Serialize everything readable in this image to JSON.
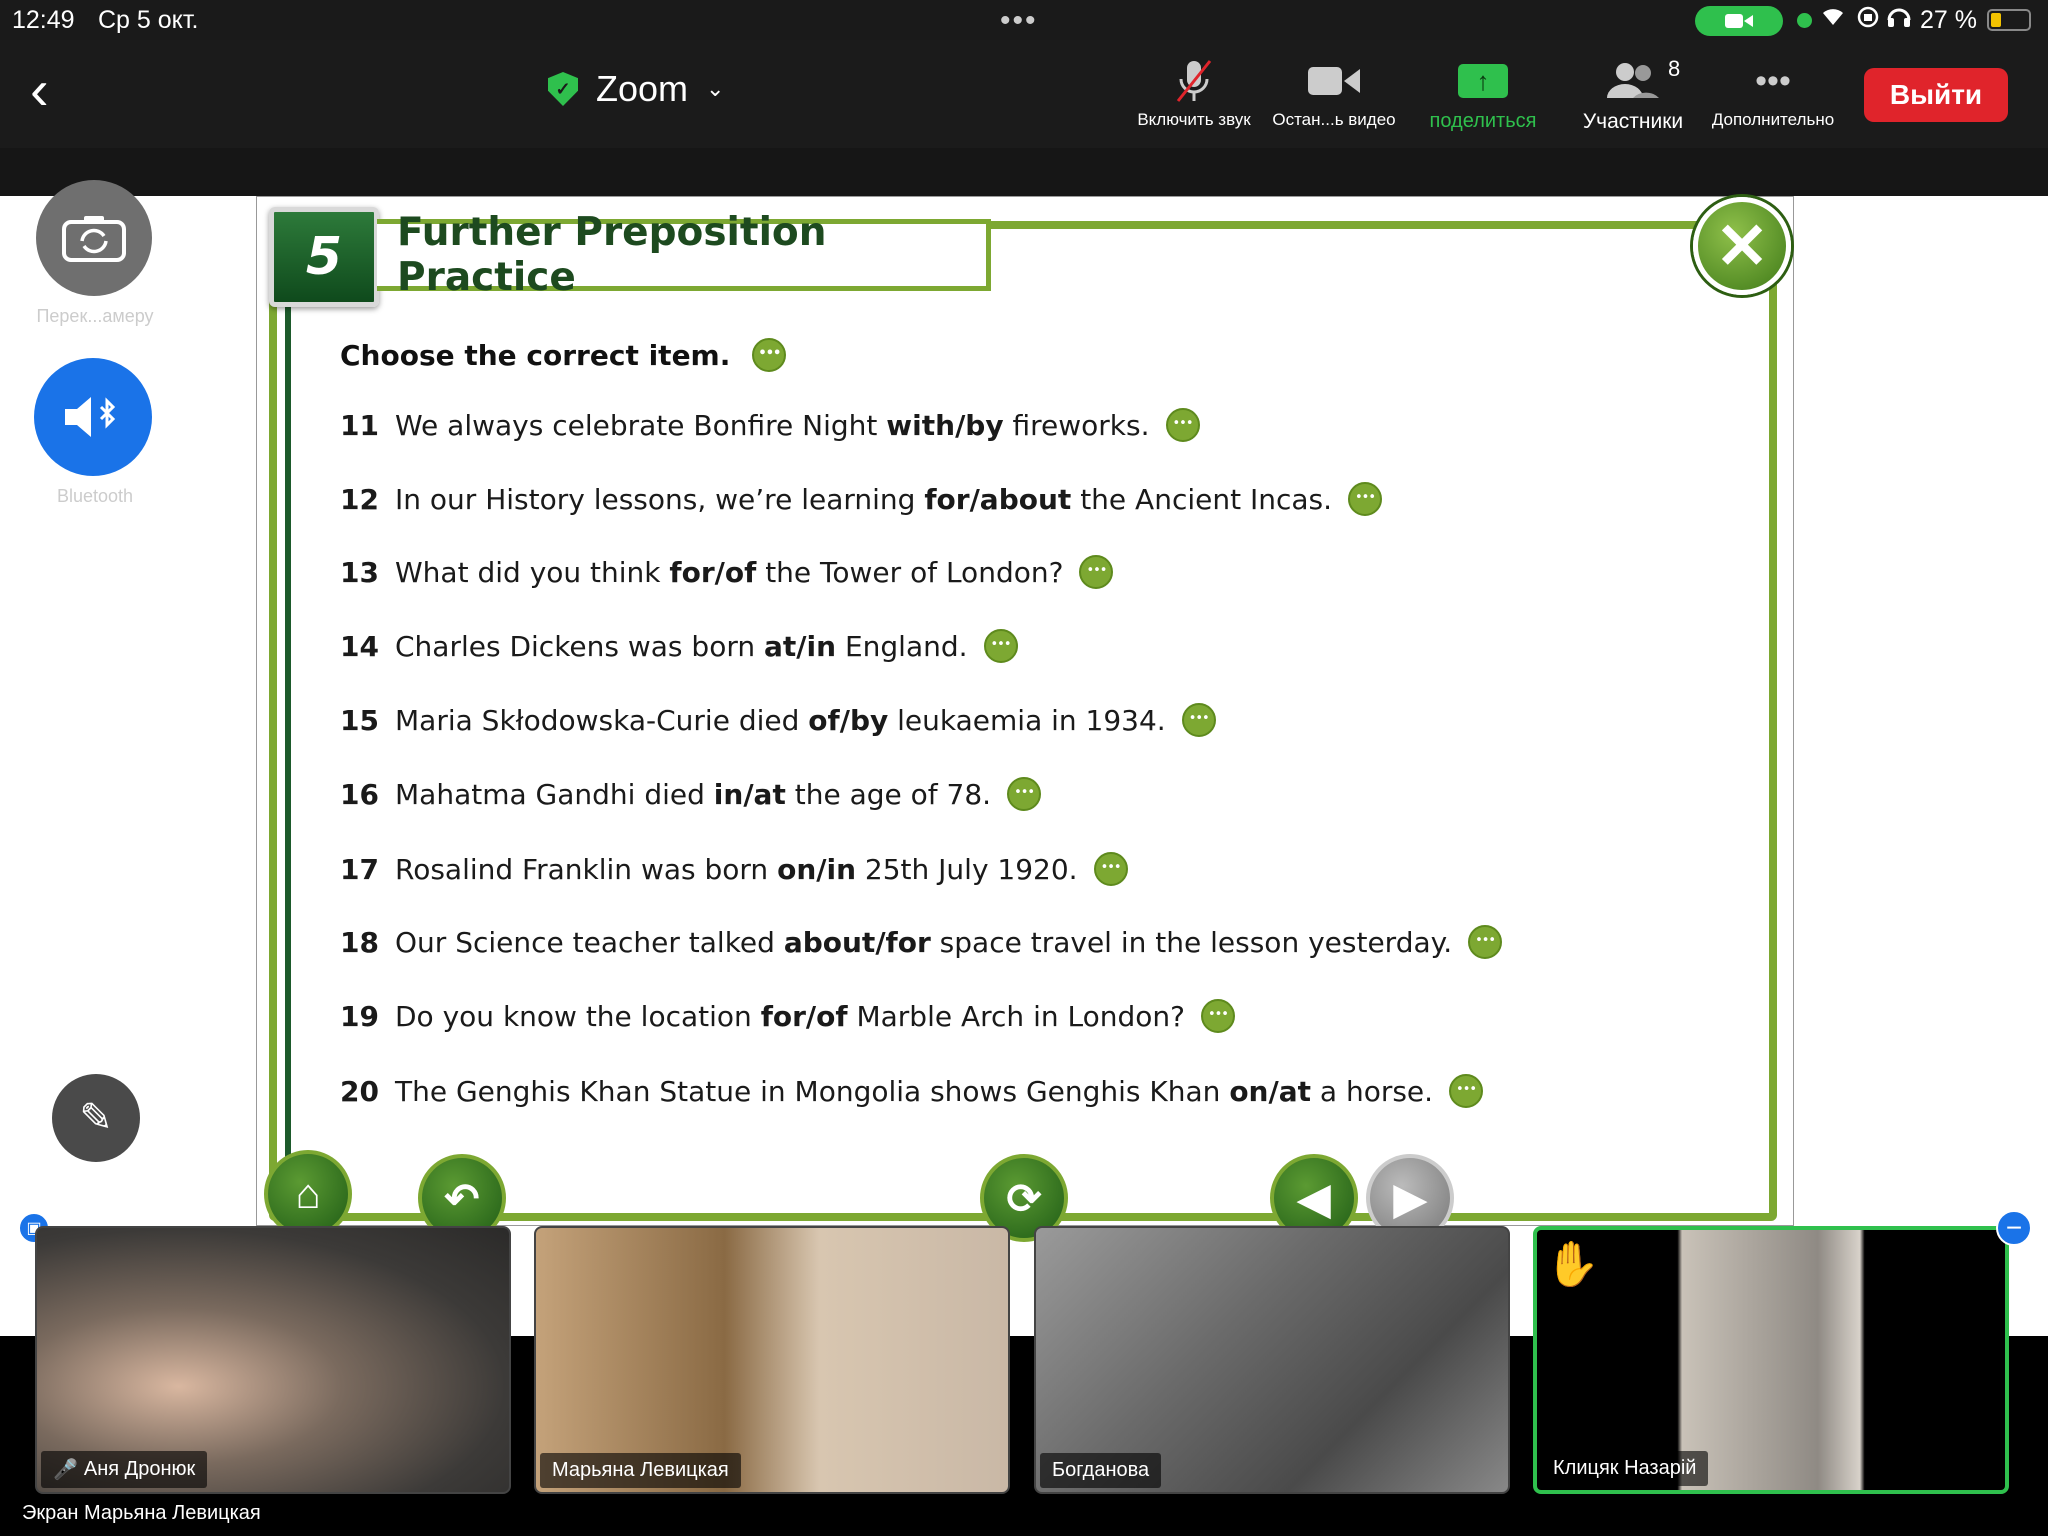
{
  "status": {
    "time": "12:49",
    "date": "Ср 5 окт.",
    "battery": "27 %",
    "battery_level": 0.27
  },
  "toolbar": {
    "title": "Zoom",
    "unmute_label": "Включить звук",
    "video_label": "Остан...ь видео",
    "share_label": "поделиться",
    "participants_label": "Участники",
    "participants_count": "8",
    "more_label": "Дополнительно",
    "leave_label": "Выйти"
  },
  "side": {
    "switch_camera_label": "Перек...амеру",
    "bluetooth_label": "Bluetooth"
  },
  "slide": {
    "number": "5",
    "title": "Further Preposition Practice",
    "instruction": "Choose the correct item.",
    "questions": [
      {
        "n": "11",
        "pre": "We always celebrate Bonfire Night ",
        "bold": "with/by",
        "post": " fireworks."
      },
      {
        "n": "12",
        "pre": "In our History lessons, we’re learning ",
        "bold": "for/about",
        "post": " the Ancient Incas."
      },
      {
        "n": "13",
        "pre": "What did you think ",
        "bold": "for/of",
        "post": " the Tower of London?"
      },
      {
        "n": "14",
        "pre": "Charles Dickens was born ",
        "bold": "at/in",
        "post": " England."
      },
      {
        "n": "15",
        "pre": "Maria Skłodowska-Curie died ",
        "bold": "of/by",
        "post": " leukaemia in 1934."
      },
      {
        "n": "16",
        "pre": "Mahatma Gandhi died ",
        "bold": "in/at",
        "post": " the age of 78."
      },
      {
        "n": "17",
        "pre": "Rosalind Franklin was born ",
        "bold": "on/in",
        "post": " 25th July 1920."
      },
      {
        "n": "18",
        "pre": "Our Science teacher talked ",
        "bold": "about/for",
        "post": " space travel in the lesson yesterday."
      },
      {
        "n": "19",
        "pre": "Do you know the location ",
        "bold": "for/of",
        "post": " Marble Arch in London?"
      },
      {
        "n": "20",
        "pre": "The Genghis Khan Statue in Mongolia shows Genghis Khan ",
        "bold": "on/at",
        "post": " a horse."
      }
    ]
  },
  "participants": [
    {
      "name": "Аня Дронюк",
      "muted": true
    },
    {
      "name": "Марьяна Левицкая",
      "muted": false
    },
    {
      "name": "Богданова",
      "muted": false
    },
    {
      "name": "Клицяк Назарій",
      "muted": false,
      "hand_raised": true
    }
  ],
  "screen_share_label": "Экран Марьяна Левицкая",
  "colors": {
    "accent_green": "#2fc04d",
    "leave_red": "#e0242b",
    "slide_green": "#7da832",
    "bluetooth_blue": "#1a73e8"
  }
}
